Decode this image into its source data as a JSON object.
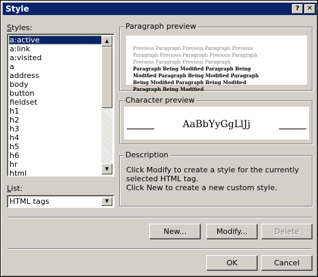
{
  "window": {
    "title": "Style",
    "help_label": "?",
    "close_label": "✕"
  },
  "styles": {
    "label": "Styles:",
    "items": [
      "a:active",
      "a:link",
      "a:visited",
      "a",
      "address",
      "body",
      "button",
      "fieldset",
      "h1",
      "h2",
      "h3",
      "h4",
      "h5",
      "h6",
      "hr",
      "html"
    ],
    "selected": "a:active"
  },
  "list": {
    "label": "List:",
    "value": "HTML tags"
  },
  "paragraph_preview": {
    "legend": "Paragraph preview",
    "previous_text": "Previous Paragraph Previous Paragraph Previous Paragraph Previous Paragraph Previous Paragraph Previous Paragraph Previous Paragraph",
    "modified_text": "Paragraph Being Modified Paragraph Being Modified Paragraph Being Modified Paragraph Being Modified Paragraph Being Modified Paragraph Being Modified"
  },
  "character_preview": {
    "legend": "Character preview",
    "sample": "AaBbYyGgLlJj"
  },
  "description": {
    "legend": "Description",
    "text": "Click Modify to create a style for the currently selected HTML tag.\nClick New to create a new custom style."
  },
  "buttons": {
    "new": "New...",
    "modify": "Modify...",
    "delete": "Delete",
    "ok": "OK",
    "cancel": "Cancel"
  }
}
